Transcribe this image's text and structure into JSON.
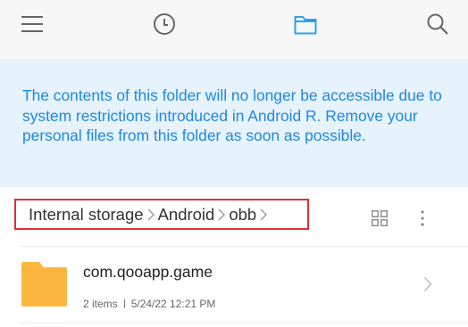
{
  "toolbar": {
    "icons": [
      "menu-icon",
      "clock-icon",
      "folder-icon",
      "search-icon"
    ],
    "active_color": "#29a3e8",
    "icon_color": "#666666"
  },
  "banner": {
    "message": "The contents of this folder will no longer be accessible due to system restrictions introduced in Android R. Remove your personal files from this folder as soon as possible.",
    "background": "#e6f2fc",
    "text_color": "#1e88e5"
  },
  "path": {
    "crumbs": [
      "Internal storage",
      "Android",
      "obb"
    ]
  },
  "files": [
    {
      "name": "com.qooapp.game",
      "items": "2 items",
      "modified": "5/24/22 12:21 PM",
      "icon": "folder-icon",
      "icon_color": "#fbb73f"
    }
  ]
}
